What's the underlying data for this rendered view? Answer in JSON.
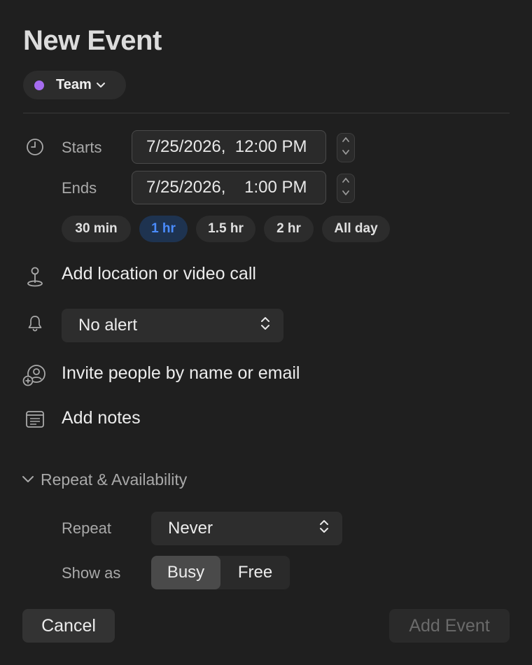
{
  "header": {
    "title": "New Event"
  },
  "calendar": {
    "name": "Team",
    "color": "#a66cf0"
  },
  "time": {
    "starts_label": "Starts",
    "starts_value": "7/25/2026,  12:00 PM",
    "ends_label": "Ends",
    "ends_value": "7/25/2026,    1:00 PM",
    "durations": [
      "30 min",
      "1 hr",
      "1.5 hr",
      "2 hr",
      "All day"
    ],
    "selected_duration": "1 hr"
  },
  "location": {
    "placeholder": "Add location or video call"
  },
  "alert": {
    "value": "No alert"
  },
  "invitees": {
    "placeholder": "Invite people by name or email"
  },
  "notes": {
    "placeholder": "Add notes"
  },
  "repeat_section": {
    "title": "Repeat & Availability",
    "repeat_label": "Repeat",
    "repeat_value": "Never",
    "show_as_label": "Show as",
    "show_as_options": [
      "Busy",
      "Free"
    ],
    "show_as_selected": "Busy"
  },
  "footer": {
    "cancel_label": "Cancel",
    "add_label": "Add Event"
  },
  "colors": {
    "accent": "#4a8cff",
    "accent_bg": "#1e3350",
    "background": "#1f1f1f"
  }
}
